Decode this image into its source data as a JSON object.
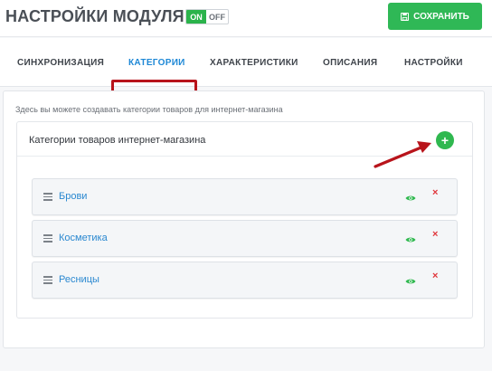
{
  "header": {
    "title": "НАСТРОЙКИ МОДУЛЯ",
    "toggle_on": "ON",
    "toggle_off": "OFF",
    "save_label": "СОХРАНИТЬ"
  },
  "tabs": [
    {
      "label": "СИНХРОНИЗАЦИЯ"
    },
    {
      "label": "КАТЕГОРИИ"
    },
    {
      "label": "ХАРАКТЕРИСТИКИ"
    },
    {
      "label": "ОПИСАНИЯ"
    },
    {
      "label": "НАСТРОЙКИ"
    }
  ],
  "active_tab": "КАТЕГОРИИ",
  "intro": "Здесь вы можете создавать категории товаров для интернет-магазина",
  "card": {
    "title": "Категории товаров интернет-магазина",
    "add_symbol": "+"
  },
  "categories": [
    {
      "label": "Брови",
      "delete_symbol": "×"
    },
    {
      "label": "Косметика",
      "delete_symbol": "×"
    },
    {
      "label": "Ресницы",
      "delete_symbol": "×"
    }
  ],
  "colors": {
    "accent": "#1e88d6",
    "success": "#2fb856",
    "danger": "#e0353b",
    "annotation": "#b8141b"
  },
  "icons": {
    "save": "save-icon",
    "add": "plus-icon",
    "drag": "drag-handle-icon",
    "visibility": "eye-icon",
    "delete": "close-icon",
    "annotation": "arrow-icon"
  }
}
